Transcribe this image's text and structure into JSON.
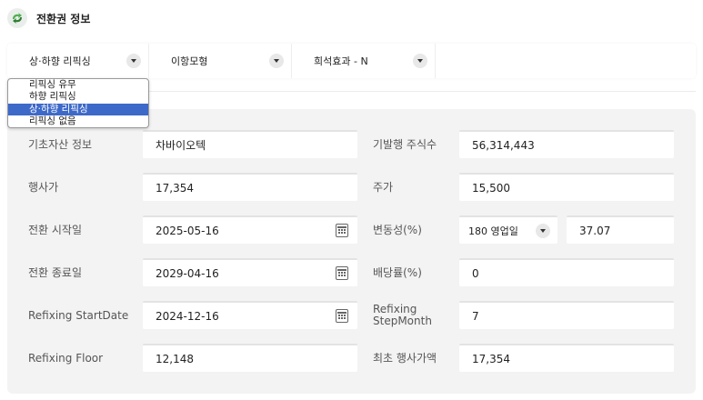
{
  "header": {
    "title": "전환권 정보"
  },
  "toolbar": {
    "refixing_select": {
      "value": "상·하향 리픽싱"
    },
    "model_select": {
      "value": "이항모형"
    },
    "dilution_select": {
      "value": "희석효과 - N"
    }
  },
  "dropdown": {
    "options": [
      "리픽싱 유무",
      "하향 리픽싱",
      "상·하향 리픽싱",
      "리픽싱 없음"
    ],
    "selected_index": 2
  },
  "form": {
    "underlying_label": "기초자산 정보",
    "underlying_value": "차바이오텍",
    "shares_label": "기발행 주식수",
    "shares_value": "56,314,443",
    "exercise_price_label": "행사가",
    "exercise_price_value": "17,354",
    "stock_price_label": "주가",
    "stock_price_value": "15,500",
    "conversion_start_label": "전환 시작일",
    "conversion_start_value": "2025-05-16",
    "volatility_label": "변동성(%)",
    "volatility_period_value": "180 영업일",
    "volatility_value": "37.07",
    "conversion_end_label": "전환 종료일",
    "conversion_end_value": "2029-04-16",
    "dividend_label": "배당률(%)",
    "dividend_value": "0",
    "refixing_start_label": "Refixing StartDate",
    "refixing_start_value": "2024-12-16",
    "refixing_step_label_1": "Refixing",
    "refixing_step_label_2": "StepMonth",
    "refixing_step_value": "7",
    "refixing_floor_label": "Refixing Floor",
    "refixing_floor_value": "12,148",
    "initial_price_label": "최초 행사가액",
    "initial_price_value": "17,354"
  },
  "colors": {
    "accent": "#3d69c9",
    "panel": "#f3f3f3",
    "logo_green": "#4caf50"
  }
}
